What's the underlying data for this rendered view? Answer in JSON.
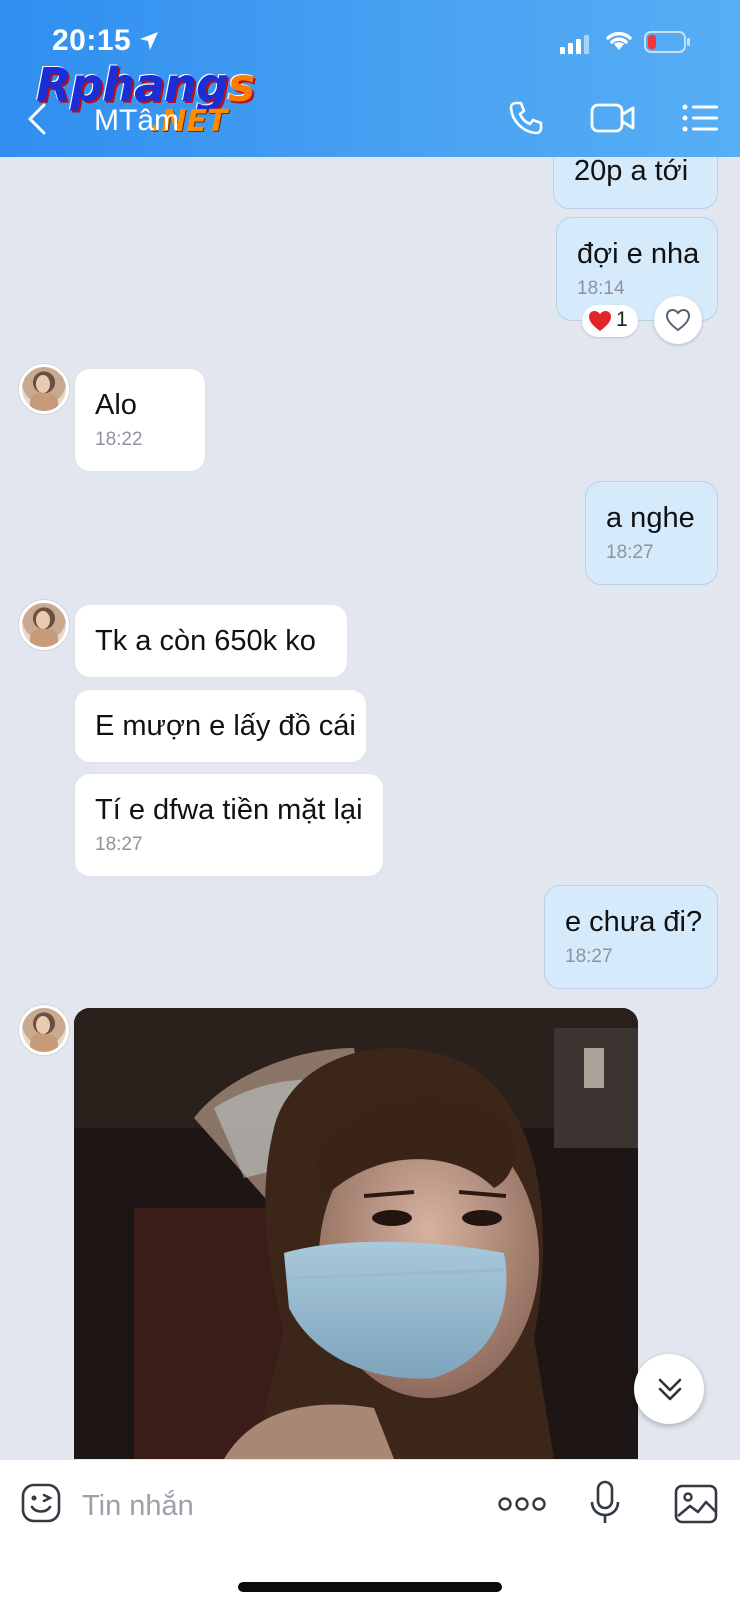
{
  "status_bar": {
    "time": "20:15"
  },
  "watermark": {
    "main": "Rphang",
    "s": "s",
    "sub": ".NET"
  },
  "header": {
    "contact_name": "MTâm"
  },
  "messages": [
    {
      "text": "20p a tới"
    },
    {
      "text": "đợi e nha",
      "time": "18:14"
    },
    {
      "text": "Alo",
      "time": "18:22"
    },
    {
      "text": "a nghe",
      "time": "18:27"
    },
    {
      "text": "Tk a còn 650k ko"
    },
    {
      "text": "E mượn e lấy đồ cái"
    },
    {
      "text": "Tí e dfwa tiền mặt lại",
      "time": "18:27"
    },
    {
      "text": "e chưa đi?",
      "time": "18:27"
    }
  ],
  "reaction": {
    "count": "1"
  },
  "composer": {
    "placeholder": "Tin nhắn"
  },
  "colors": {
    "header_start": "#2f8ef0",
    "chat_bg": "#e2e6ef",
    "outgoing_bubble": "#d5ebfc",
    "incoming_bubble": "#ffffff"
  },
  "icons": [
    "location-arrow-icon",
    "signal-icon",
    "wifi-icon",
    "battery-icon",
    "back-icon",
    "phone-icon",
    "video-icon",
    "menu-icon",
    "heart-icon",
    "scroll-down-icon",
    "sticker-icon",
    "more-icon",
    "mic-icon",
    "image-icon"
  ]
}
